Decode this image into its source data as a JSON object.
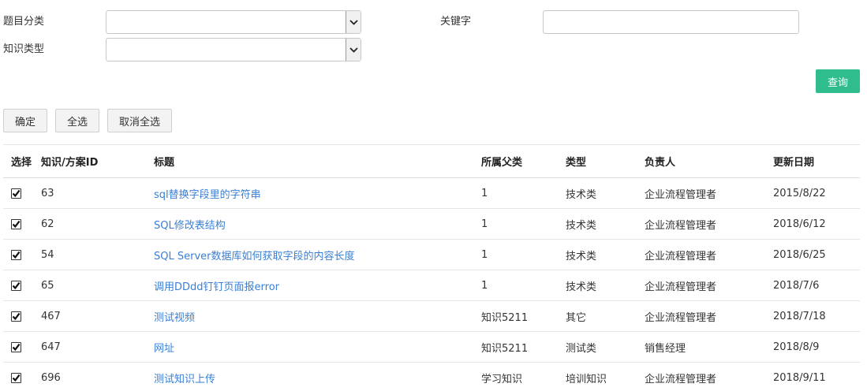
{
  "filters": {
    "category_label": "题目分类",
    "category_value": "",
    "keyword_label": "关键字",
    "keyword_value": "",
    "type_label": "知识类型",
    "type_value": ""
  },
  "buttons": {
    "query": "查询",
    "confirm": "确定",
    "select_all": "全选",
    "deselect_all": "取消全选"
  },
  "table": {
    "headers": [
      "选择",
      "知识/方案ID",
      "标题",
      "所属父类",
      "类型",
      "负责人",
      "更新日期"
    ],
    "rows": [
      {
        "checked": true,
        "id": "63",
        "title": "sql替换字段里的字符串",
        "parent": "1",
        "type": "技术类",
        "owner": "企业流程管理者",
        "date": "2015/8/22"
      },
      {
        "checked": true,
        "id": "62",
        "title": "SQL修改表结构",
        "parent": "1",
        "type": "技术类",
        "owner": "企业流程管理者",
        "date": "2018/6/12"
      },
      {
        "checked": true,
        "id": "54",
        "title": "SQL Server数据库如何获取字段的内容长度",
        "parent": "1",
        "type": "技术类",
        "owner": "企业流程管理者",
        "date": "2018/6/25"
      },
      {
        "checked": true,
        "id": "65",
        "title": "调用DDdd钉钉页面报error",
        "parent": "1",
        "type": "技术类",
        "owner": "企业流程管理者",
        "date": "2018/7/6"
      },
      {
        "checked": true,
        "id": "467",
        "title": "测试视频",
        "parent": "知识5211",
        "type": "其它",
        "owner": "企业流程管理者",
        "date": "2018/7/18"
      },
      {
        "checked": true,
        "id": "647",
        "title": "网址",
        "parent": "知识5211",
        "type": "测试类",
        "owner": "销售经理",
        "date": "2018/8/9"
      },
      {
        "checked": true,
        "id": "696",
        "title": "测试知识上传",
        "parent": "学习知识",
        "type": "培训知识",
        "owner": "企业流程管理者",
        "date": "2018/9/11"
      }
    ]
  }
}
